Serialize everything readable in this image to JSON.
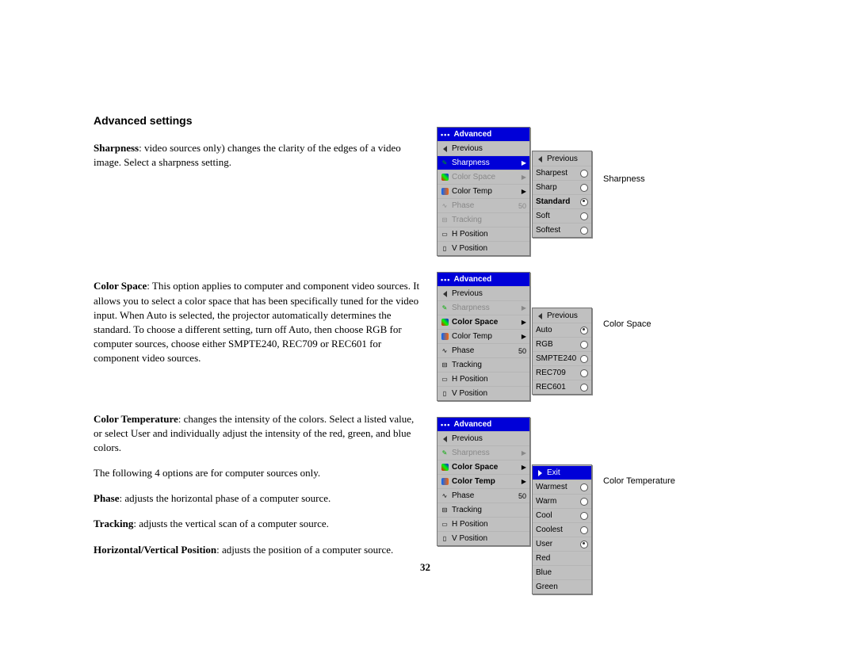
{
  "heading": "Advanced settings",
  "paragraphs": {
    "sharpness_b": "Sharpness",
    "sharpness_t": ": video sources only) changes the clarity of the edges of a video image. Select a sharpness setting.",
    "colorspace_b": "Color Space",
    "colorspace_t": ": This option applies to computer and component video sources. It allows you to select a color space that has been specifically tuned for the video input. When Auto is selected, the projector automatically determines the standard. To choose a different setting, turn off Auto, then choose RGB for computer sources, choose either SMPTE240, REC709 or REC601 for component video sources.",
    "colortemp_b": "Color Temperature",
    "colortemp_t": ": changes the intensity of the colors. Select a listed value, or select User and individually adjust the intensity of the red, green, and blue colors.",
    "four_opts": "The following 4 options are for computer sources only.",
    "phase_b": "Phase",
    "phase_t": ": adjusts the horizontal phase of a computer source.",
    "tracking_b": "Tracking",
    "tracking_t": ": adjusts the vertical scan of a computer source.",
    "hv_b": "Horizontal/Vertical Position",
    "hv_t": ": adjusts the position of a computer source."
  },
  "pagenum": "32",
  "menus": {
    "adv_title": "Advanced",
    "adv": {
      "previous": "Previous",
      "sharpness": "Sharpness",
      "colorspace": "Color Space",
      "colortemp": "Color Temp",
      "phase": "Phase",
      "phase_val": "50",
      "tracking": "Tracking",
      "hpos": "H Position",
      "vpos": "V Position"
    },
    "sharp_sub": {
      "previous": "Previous",
      "sharpest": "Sharpest",
      "sharp": "Sharp",
      "standard": "Standard",
      "soft": "Soft",
      "softest": "Softest"
    },
    "cs_sub": {
      "previous": "Previous",
      "auto": "Auto",
      "rgb": "RGB",
      "smpte": "SMPTE240",
      "rec709": "REC709",
      "rec601": "REC601"
    },
    "ct_sub": {
      "exit": "Exit",
      "warmest": "Warmest",
      "warm": "Warm",
      "cool": "Cool",
      "coolest": "Coolest",
      "user": "User",
      "red": "Red",
      "blue": "Blue",
      "green": "Green"
    }
  },
  "labels": {
    "sharpness": "Sharpness",
    "colorspace": "Color Space",
    "colortemp": "Color Temperature"
  }
}
